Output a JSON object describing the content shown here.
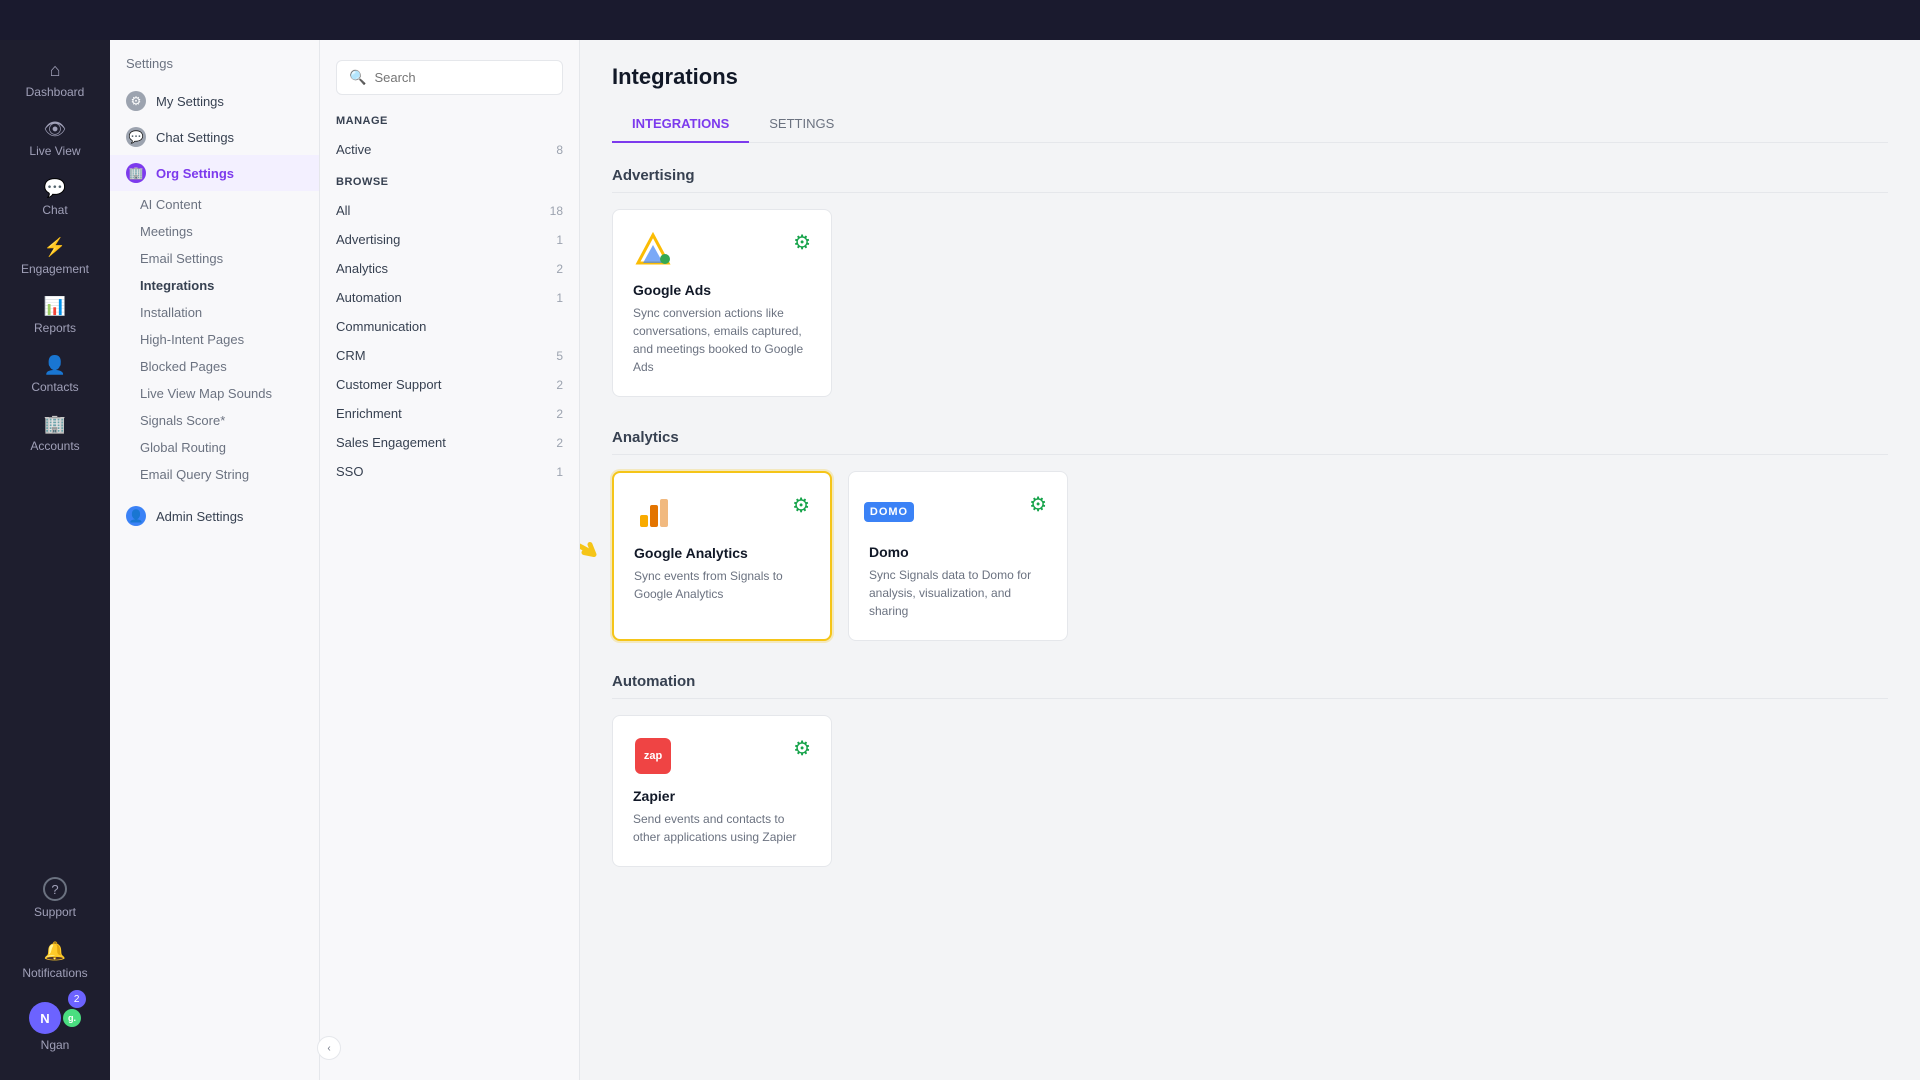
{
  "topBar": {},
  "farLeftNav": {
    "items": [
      {
        "id": "dashboard",
        "label": "Dashboard",
        "icon": "⌂"
      },
      {
        "id": "live-view",
        "label": "Live View",
        "icon": "👁"
      },
      {
        "id": "chat",
        "label": "Chat",
        "icon": "💬"
      },
      {
        "id": "engagement",
        "label": "Engagement",
        "icon": "⚡"
      },
      {
        "id": "reports",
        "label": "Reports",
        "icon": "📊"
      },
      {
        "id": "contacts",
        "label": "Contacts",
        "icon": "👤"
      },
      {
        "id": "accounts",
        "label": "Accounts",
        "icon": "🏢"
      }
    ],
    "bottom": [
      {
        "id": "support",
        "label": "Support",
        "icon": "?"
      },
      {
        "id": "notifications",
        "label": "Notifications",
        "icon": "🔔"
      }
    ],
    "user": {
      "name": "Ngan",
      "initial": "g.",
      "badge": "2"
    }
  },
  "settingsPanel": {
    "title": "Settings",
    "items": [
      {
        "id": "my-settings",
        "label": "My Settings",
        "icon": "⚙",
        "iconStyle": "gray-bg"
      },
      {
        "id": "chat-settings",
        "label": "Chat Settings",
        "icon": "💬",
        "iconStyle": "gray-bg"
      },
      {
        "id": "org-settings",
        "label": "Org Settings",
        "icon": "🏢",
        "iconStyle": "purple-bg",
        "active": true
      },
      {
        "id": "admin-settings",
        "label": "Admin Settings",
        "icon": "👤",
        "iconStyle": "blue-bg"
      }
    ],
    "subItems": [
      {
        "id": "ai-content",
        "label": "AI Content",
        "parentId": "org-settings"
      },
      {
        "id": "meetings",
        "label": "Meetings",
        "parentId": "org-settings"
      },
      {
        "id": "email-settings",
        "label": "Email Settings",
        "parentId": "org-settings"
      },
      {
        "id": "integrations",
        "label": "Integrations",
        "parentId": "org-settings",
        "active": true
      },
      {
        "id": "installation",
        "label": "Installation",
        "parentId": "org-settings"
      },
      {
        "id": "high-intent-pages",
        "label": "High-Intent Pages",
        "parentId": "org-settings"
      },
      {
        "id": "blocked-pages",
        "label": "Blocked Pages",
        "parentId": "org-settings"
      },
      {
        "id": "live-view-map-sounds",
        "label": "Live View Map Sounds",
        "parentId": "org-settings"
      },
      {
        "id": "signals-score",
        "label": "Signals Score*",
        "parentId": "org-settings"
      },
      {
        "id": "global-routing",
        "label": "Global Routing",
        "parentId": "org-settings"
      },
      {
        "id": "email-query-string",
        "label": "Email Query String",
        "parentId": "org-settings"
      }
    ]
  },
  "filterPanel": {
    "search": {
      "placeholder": "Search"
    },
    "manageSection": {
      "title": "MANAGE",
      "items": [
        {
          "id": "active",
          "label": "Active",
          "count": "8"
        }
      ]
    },
    "browseSection": {
      "title": "BROWSE",
      "items": [
        {
          "id": "all",
          "label": "All",
          "count": "18"
        },
        {
          "id": "advertising",
          "label": "Advertising",
          "count": "1"
        },
        {
          "id": "analytics",
          "label": "Analytics",
          "count": "2"
        },
        {
          "id": "automation",
          "label": "Automation",
          "count": "1"
        },
        {
          "id": "communication",
          "label": "Communication",
          "count": ""
        },
        {
          "id": "crm",
          "label": "CRM",
          "count": "5"
        },
        {
          "id": "customer-support",
          "label": "Customer Support",
          "count": "2"
        },
        {
          "id": "enrichment",
          "label": "Enrichment",
          "count": "2"
        },
        {
          "id": "sales-engagement",
          "label": "Sales Engagement",
          "count": "2"
        },
        {
          "id": "sso",
          "label": "SSO",
          "count": "1"
        }
      ]
    }
  },
  "mainContent": {
    "pageTitle": "Integrations",
    "tabs": [
      {
        "id": "integrations",
        "label": "INTEGRATIONS",
        "active": true
      },
      {
        "id": "settings",
        "label": "SETTINGS",
        "active": false
      }
    ],
    "sections": [
      {
        "id": "advertising",
        "title": "Advertising",
        "cards": [
          {
            "id": "google-ads",
            "name": "Google Ads",
            "desc": "Sync conversion actions like conversations, emails captured, and meetings booked to Google Ads",
            "logoType": "google-ads",
            "hasGear": true,
            "highlighted": false
          }
        ]
      },
      {
        "id": "analytics",
        "title": "Analytics",
        "cards": [
          {
            "id": "google-analytics",
            "name": "Google Analytics",
            "desc": "Sync events from Signals to Google Analytics",
            "logoType": "google-analytics",
            "hasGear": true,
            "highlighted": true
          },
          {
            "id": "domo",
            "name": "Domo",
            "desc": "Sync Signals data to Domo for analysis, visualization, and sharing",
            "logoType": "domo",
            "hasGear": true,
            "highlighted": false
          }
        ]
      },
      {
        "id": "automation",
        "title": "Automation",
        "cards": [
          {
            "id": "zapier",
            "name": "Zapier",
            "desc": "Send events and contacts to other applications using Zapier",
            "logoType": "zapier",
            "hasGear": true,
            "highlighted": false
          }
        ]
      }
    ]
  },
  "collapseBtn": {
    "icon": "‹"
  }
}
